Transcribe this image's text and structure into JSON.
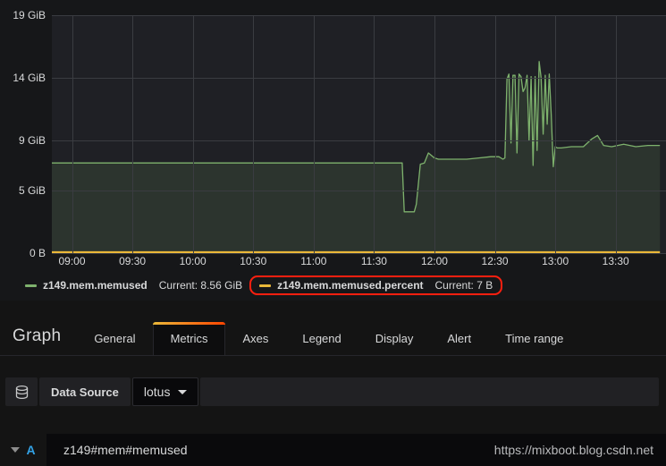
{
  "chart_data": {
    "type": "line",
    "title": "",
    "xlabel": "",
    "ylabel": "",
    "grid": true,
    "legend_position": "bottom",
    "y_ticks": [
      "0 B",
      "5 GiB",
      "9 GiB",
      "14 GiB",
      "19 GiB"
    ],
    "y_tick_values": [
      0,
      5,
      9,
      14,
      19
    ],
    "ylim": [
      0,
      19
    ],
    "x_ticks": [
      "09:00",
      "09:30",
      "10:00",
      "10:30",
      "11:00",
      "11:30",
      "12:00",
      "12:30",
      "13:00",
      "13:30"
    ],
    "xlim": [
      "08:50",
      "13:55"
    ],
    "series": [
      {
        "name": "z149.mem.memused",
        "color": "#7eb26d",
        "fill": true,
        "unit": "GiB",
        "x": [
          "08:50",
          "09:00",
          "09:30",
          "10:00",
          "10:30",
          "11:00",
          "11:20",
          "11:40",
          "11:44",
          "11:45",
          "11:50",
          "11:51",
          "11:53",
          "11:55",
          "11:57",
          "12:00",
          "12:02",
          "12:06",
          "12:10",
          "12:16",
          "12:22",
          "12:28",
          "12:32",
          "12:34",
          "12:35",
          "12:36",
          "12:37",
          "12:38",
          "12:39",
          "12:40",
          "12:41",
          "12:42",
          "12:43",
          "12:44",
          "12:45",
          "12:46",
          "12:47",
          "12:48",
          "12:49",
          "12:50",
          "12:51",
          "12:52",
          "12:53",
          "12:54",
          "12:55",
          "12:56",
          "12:57",
          "12:58",
          "12:59",
          "13:00",
          "13:01",
          "13:03",
          "13:08",
          "13:14",
          "13:18",
          "13:21",
          "13:24",
          "13:28",
          "13:34",
          "13:40",
          "13:46",
          "13:52"
        ],
        "y": [
          7.2,
          7.2,
          7.2,
          7.2,
          7.2,
          7.2,
          7.2,
          7.2,
          7.2,
          3.3,
          3.3,
          3.9,
          7.1,
          7.2,
          8.0,
          7.6,
          7.5,
          7.5,
          7.5,
          7.5,
          7.6,
          7.7,
          7.7,
          7.5,
          7.6,
          13.9,
          14.3,
          8.8,
          14.2,
          14.2,
          8.0,
          14.3,
          14.1,
          12.9,
          13.2,
          14.2,
          9.0,
          14.1,
          7.0,
          14.1,
          8.2,
          15.3,
          14.0,
          9.5,
          14.2,
          10.3,
          14.3,
          11.1,
          6.9,
          8.5,
          8.4,
          8.4,
          8.5,
          8.5,
          9.1,
          9.4,
          8.6,
          8.5,
          8.7,
          8.5,
          8.6,
          8.6
        ]
      },
      {
        "name": "z149.mem.memused.percent",
        "color": "#eab839",
        "fill": false,
        "unit": "B",
        "x": [
          "08:50",
          "13:52"
        ],
        "y": [
          0.07,
          0.07
        ]
      }
    ],
    "legend": [
      {
        "name": "z149.mem.memused",
        "color": "#7eb26d",
        "stat_label": "Current:",
        "stat_value": "8.56 GiB",
        "highlighted": false
      },
      {
        "name": "z149.mem.memused.percent",
        "color": "#eab839",
        "stat_label": "Current:",
        "stat_value": "7 B",
        "highlighted": true
      }
    ]
  },
  "editor": {
    "panel_title": "Graph",
    "tabs": [
      {
        "label": "General",
        "active": false
      },
      {
        "label": "Metrics",
        "active": true
      },
      {
        "label": "Axes",
        "active": false
      },
      {
        "label": "Legend",
        "active": false
      },
      {
        "label": "Display",
        "active": false
      },
      {
        "label": "Alert",
        "active": false
      },
      {
        "label": "Time range",
        "active": false
      }
    ],
    "datasource": {
      "icon": "database-icon",
      "label": "Data Source",
      "selected": "lotus"
    },
    "query": {
      "letter": "A",
      "text": "z149#mem#memused"
    }
  },
  "watermark": "https://mixboot.blog.csdn.net",
  "colors": {
    "background": "#161719",
    "plot_background": "#1f2025",
    "grid": "#3a3c41",
    "series_green": "#7eb26d",
    "series_yellow": "#eab839",
    "highlight_red": "#ff1f0f",
    "text": "#d8d9da",
    "query_letter": "#33a2e5"
  }
}
